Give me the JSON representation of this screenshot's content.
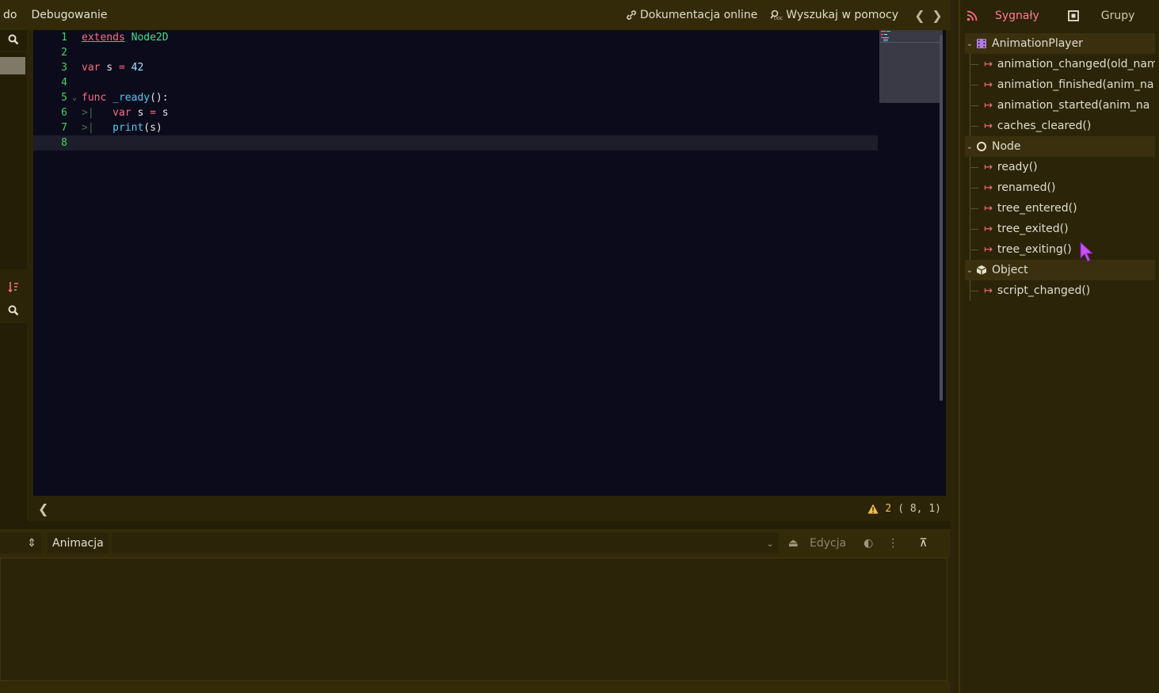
{
  "menu": {
    "item1": "do",
    "item2": "Debugowanie"
  },
  "links": {
    "online_docs": "Dokumentacja online",
    "search_help": "Wyszukaj w pomocy",
    "prev": "❮",
    "next": "❯"
  },
  "editor": {
    "line_numbers": [
      "1",
      "2",
      "3",
      "4",
      "5",
      "6",
      "7",
      "8"
    ],
    "lines": {
      "l1_kw": "extends",
      "l1_cls": "Node2D",
      "l3_kw": "var",
      "l3_name": " s ",
      "l3_op": "=",
      "l3_num": " 42",
      "l5_kw": "func",
      "l5_fn": " _ready",
      "l5_rest": "():",
      "l6_kw": "var",
      "l6_rest": " s ",
      "l6_op": "=",
      "l6_rest2": " s",
      "l7_fn": "print",
      "l7_rest": "(s)"
    }
  },
  "status": {
    "back": "❮",
    "warnings": "2",
    "position": "(   8,   1)"
  },
  "bottom": {
    "animation_label": "Animacja",
    "edit_label": "Edycja"
  },
  "right_panel": {
    "tab_signals": "Sygnały",
    "tab_groups": "Grupy",
    "groups": [
      {
        "name": "AnimationPlayer",
        "items": [
          "animation_changed(old_nam",
          "animation_finished(anim_na",
          "animation_started(anim_na",
          "caches_cleared()"
        ]
      },
      {
        "name": "Node",
        "items": [
          "ready()",
          "renamed()",
          "tree_entered()",
          "tree_exited()",
          "tree_exiting()"
        ]
      },
      {
        "name": "Object",
        "items": [
          "script_changed()"
        ]
      }
    ]
  },
  "colors": {
    "accent": "#ff6b86",
    "line_number": "#3fd463",
    "warning": "#f5c04b"
  }
}
